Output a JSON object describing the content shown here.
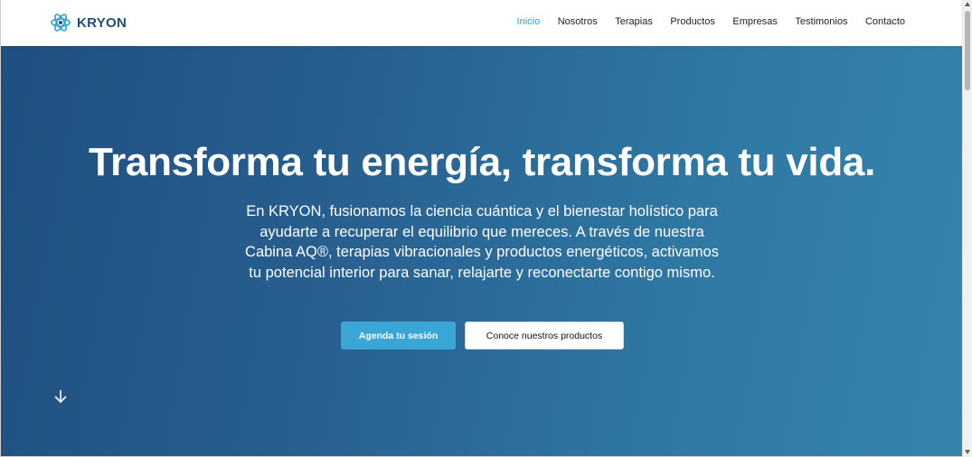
{
  "brand": {
    "name": "KRYON",
    "logo_icon": "atom-icon"
  },
  "nav": {
    "items": [
      {
        "label": "Inicio",
        "active": true
      },
      {
        "label": "Nosotros",
        "active": false
      },
      {
        "label": "Terapias",
        "active": false
      },
      {
        "label": "Productos",
        "active": false
      },
      {
        "label": "Empresas",
        "active": false
      },
      {
        "label": "Testimonios",
        "active": false
      },
      {
        "label": "Contacto",
        "active": false
      }
    ]
  },
  "hero": {
    "title": "Transforma tu energía, transforma tu vida.",
    "description": "En KRYON, fusionamos la ciencia cuántica y el bienestar holístico para ayudarte a recuperar el equilibrio que mereces. A través de nuestra Cabina AQ®, terapias vibracionales y productos energéticos, activamos tu potencial interior para sanar, relajarte y reconectarte contigo mismo.",
    "primary_button": "Agenda tu sesión",
    "secondary_button": "Conoce nuestros productos",
    "scroll_icon": "arrow-down-icon"
  },
  "colors": {
    "accent": "#2fa0cf",
    "primary_button": "#3aa6d6",
    "hero_start": "#1f4f80",
    "hero_end": "#3585ad",
    "brand_text": "#1f4d7a"
  }
}
